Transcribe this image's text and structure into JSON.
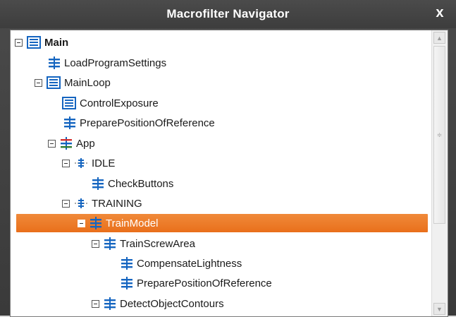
{
  "window": {
    "title": "Macrofilter Navigator",
    "close_glyph": "x"
  },
  "colors": {
    "selection": "#ee7b28",
    "icon_blue": "#1565c0",
    "icon_red": "#d32f2f",
    "icon_green": "#2e7d32"
  },
  "tree": [
    {
      "label": "Main",
      "icon": "task-icon",
      "bold": true,
      "expander": true
    },
    {
      "label": "LoadProgramSettings",
      "icon": "step-icon",
      "bold": false,
      "expander": false
    },
    {
      "label": "MainLoop",
      "icon": "task-icon",
      "bold": false,
      "expander": true
    },
    {
      "label": "ControlExposure",
      "icon": "task-icon",
      "bold": false,
      "expander": false
    },
    {
      "label": "PreparePositionOfReference",
      "icon": "step-icon",
      "bold": false,
      "expander": false
    },
    {
      "label": "App",
      "icon": "worker-icon",
      "bold": false,
      "expander": true
    },
    {
      "label": "IDLE",
      "icon": "state-icon",
      "bold": false,
      "expander": true
    },
    {
      "label": "CheckButtons",
      "icon": "step-icon",
      "bold": false,
      "expander": false
    },
    {
      "label": "TRAINING",
      "icon": "state-icon",
      "bold": false,
      "expander": true
    },
    {
      "label": "TrainModel",
      "icon": "step-icon",
      "bold": false,
      "expander": true,
      "selected": true
    },
    {
      "label": "TrainScrewArea",
      "icon": "step-icon",
      "bold": false,
      "expander": true
    },
    {
      "label": "CompensateLightness",
      "icon": "step-icon",
      "bold": false,
      "expander": false
    },
    {
      "label": "PreparePositionOfReference",
      "icon": "step-icon",
      "bold": false,
      "expander": false
    },
    {
      "label": "DetectObjectContours",
      "icon": "step-icon",
      "bold": false,
      "expander": true
    }
  ]
}
